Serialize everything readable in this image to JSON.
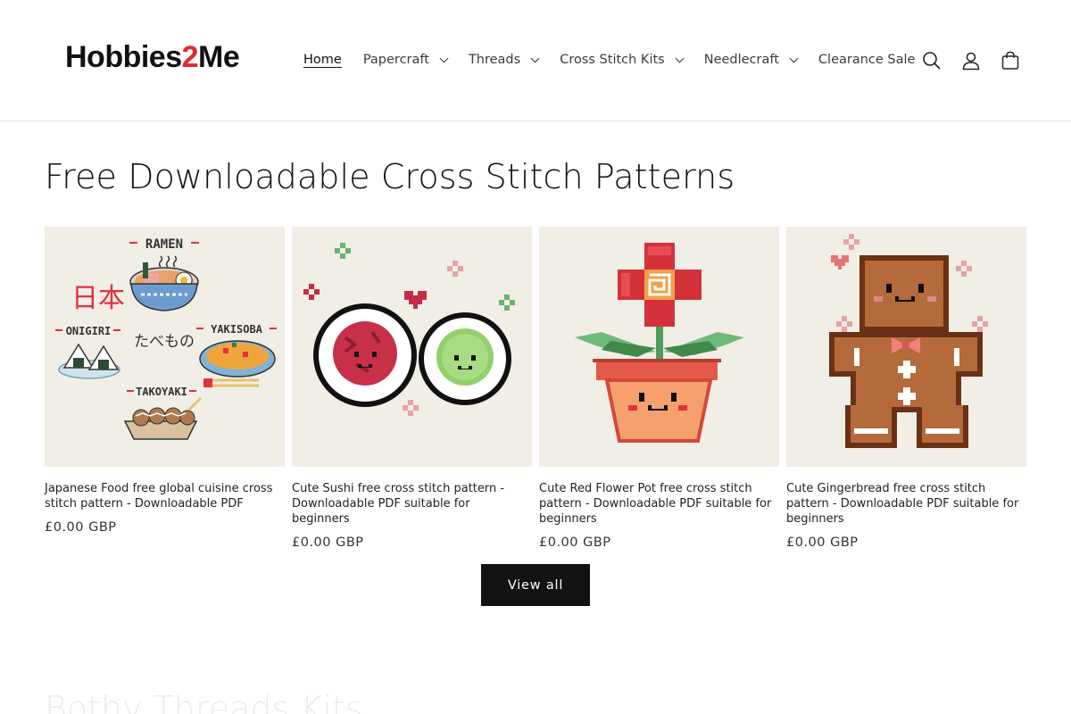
{
  "header": {
    "logo": {
      "part1": "Hobbies",
      "part2": "2",
      "part3": "Me"
    },
    "nav": [
      {
        "label": "Home",
        "active": true,
        "dropdown": false
      },
      {
        "label": "Papercraft",
        "dropdown": true
      },
      {
        "label": "Threads",
        "dropdown": true
      },
      {
        "label": "Cross Stitch Kits",
        "dropdown": true
      },
      {
        "label": "Needlecraft",
        "dropdown": true
      },
      {
        "label": "Clearance Sale",
        "dropdown": false
      }
    ],
    "icons": [
      "search-icon",
      "account-icon",
      "cart-icon"
    ]
  },
  "section": {
    "title": "Free Downloadable Cross Stitch Patterns",
    "products": [
      {
        "title": "Japanese Food free global cuisine cross stitch pattern - Downloadable PDF",
        "price": "£0.00 GBP",
        "image_text": {
          "ramen": "RAMEN",
          "kanji": "日本",
          "onigiri": "ONIGIRI",
          "tabemono": "たべもの",
          "yakisoba": "YAKISOBA",
          "takoyaki": "TAKOYAKI"
        }
      },
      {
        "title": "Cute Sushi free cross stitch pattern - Downloadable PDF suitable for beginners",
        "price": "£0.00 GBP"
      },
      {
        "title": "Cute Red Flower Pot free cross stitch pattern - Downloadable PDF suitable for beginners",
        "price": "£0.00 GBP"
      },
      {
        "title": "Cute Gingerbread free cross stitch pattern - Downloadable PDF suitable for beginners",
        "price": "£0.00 GBP"
      }
    ],
    "view_all": "View all"
  },
  "next_section": {
    "title": "Bothy Threads Kits"
  },
  "colors": {
    "accent": "#121212",
    "logo_red": "#e4262b",
    "card_bg": "#f1eee6"
  }
}
